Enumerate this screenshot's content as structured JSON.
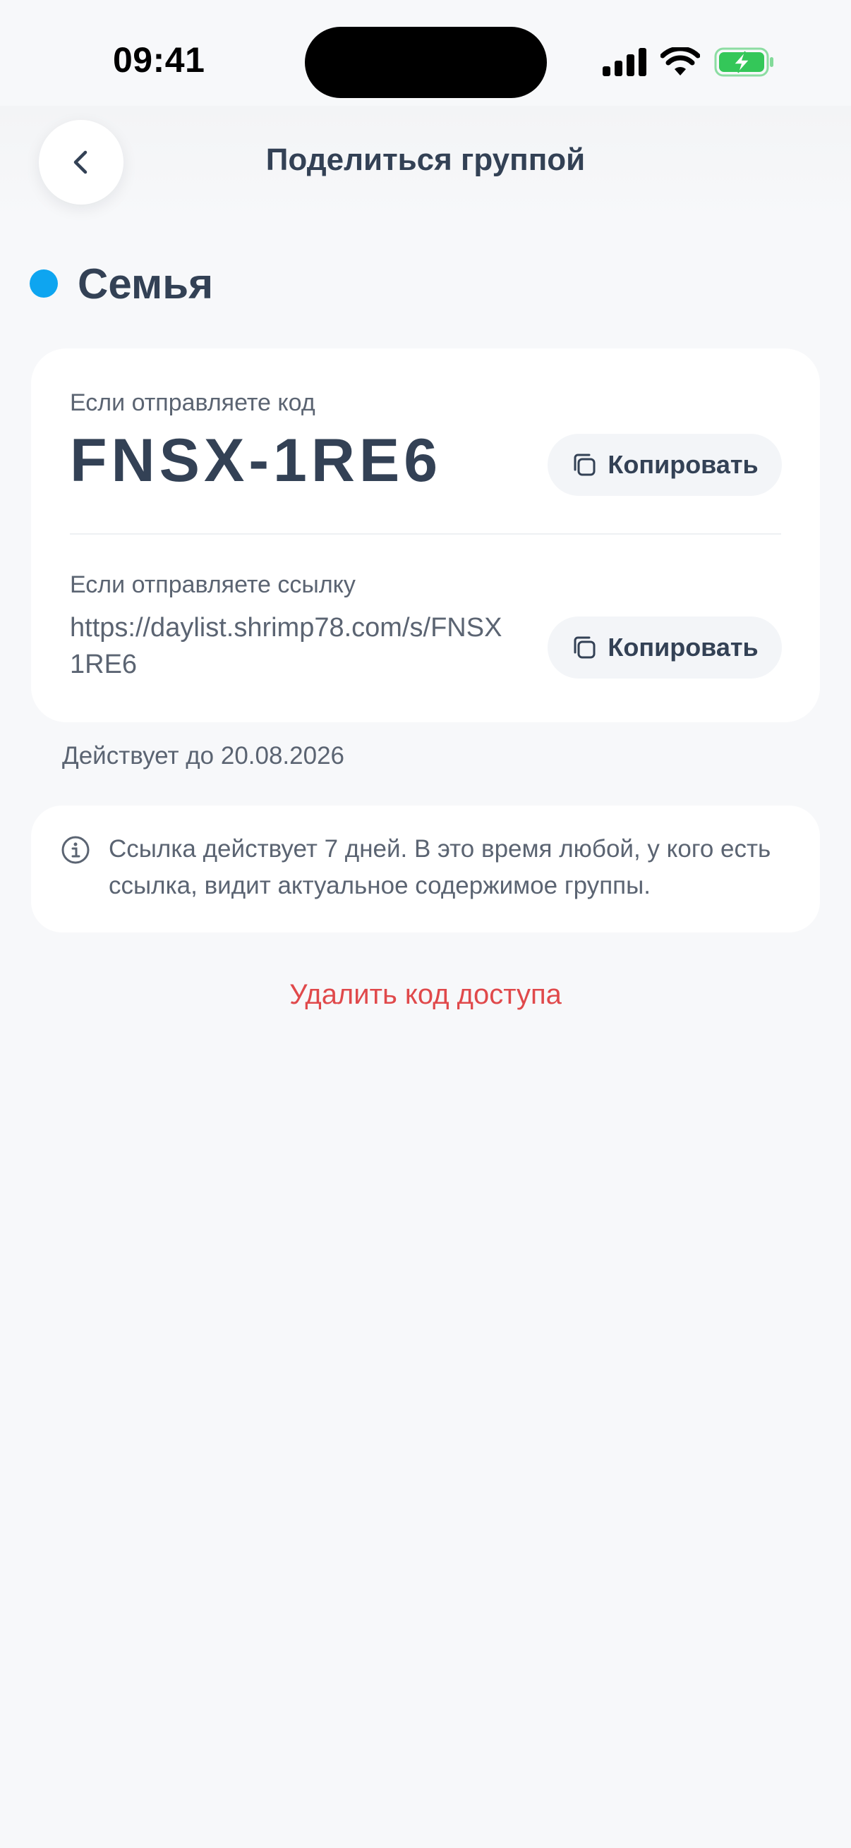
{
  "status_bar": {
    "time": "09:41",
    "icons": [
      "signal-icon",
      "wifi-icon",
      "battery-charging-icon"
    ]
  },
  "header": {
    "back_icon": "chevron-left-icon",
    "title": "Поделиться группой"
  },
  "group": {
    "name": "Семья",
    "color": "#0ea5f0"
  },
  "share": {
    "code_label": "Если отправляете код",
    "code": "FNSX-1RE6",
    "copy_code_label": "Копировать",
    "link_label": "Если отправляете ссылку",
    "link": "https://daylist.shrimp78.com/s/FNSX1RE6",
    "copy_link_label": "Копировать",
    "copy_icon": "copy-icon"
  },
  "valid_until": "Действует до 20.08.2026",
  "info": {
    "icon": "info-icon",
    "text": "Ссылка действует 7 дней. В это время любой, у кого есть ссылка, видит актуальное содержимое группы."
  },
  "delete_label": "Удалить код доступа",
  "colors": {
    "accent_text": "#334155",
    "muted_text": "#5b6472",
    "danger": "#e0494b",
    "battery": "#34c759"
  }
}
